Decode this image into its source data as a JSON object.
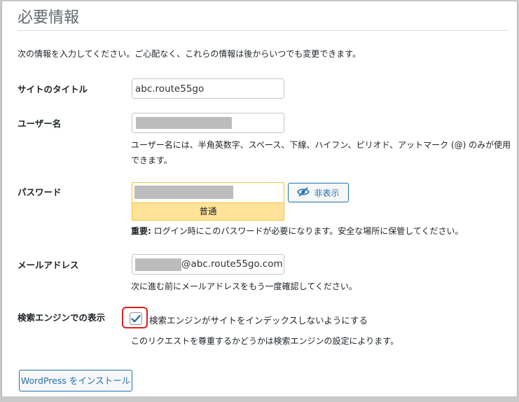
{
  "page": {
    "heading": "必要情報",
    "intro": "次の情報を入力してください。ご心配なく、これらの情報は後からいつでも変更できます。"
  },
  "site_title": {
    "label": "サイトのタイトル",
    "value": "abc.route55go"
  },
  "username": {
    "label": "ユーザー名",
    "description_line1": "ユーザー名には、半角英数字、スペース、下線、ハイフン、ピリオド、アットマーク (@) のみが使用",
    "description_line2": "できます。"
  },
  "password": {
    "label": "パスワード",
    "strength": "普通",
    "hide_button": "非表示",
    "note_prefix": "重要:",
    "note": " ログイン時にこのパスワードが必要になります。安全な場所に保管してください。"
  },
  "email": {
    "label": "メールアドレス",
    "value_suffix": "@abc.route55go.com",
    "description": "次に進む前にメールアドレスをもう一度確認してください。"
  },
  "search_engine": {
    "label": "検索エンジンでの表示",
    "checkbox_label": "検索エンジンがサイトをインデックスしないようにする",
    "checked": true,
    "description": "このリクエストを尊重するかどうかは検索エンジンの設定によります。"
  },
  "install_button": "WordPress をインストール",
  "colors": {
    "accent": "#2271b1",
    "strength_bg": "#ffe399",
    "highlight": "#e01e1e"
  }
}
